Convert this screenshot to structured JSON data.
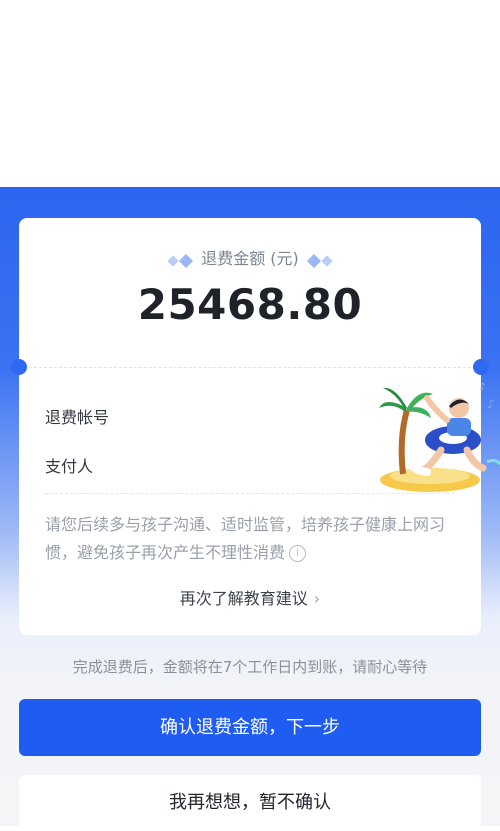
{
  "card": {
    "amount_label": "退费金额 (元)",
    "amount_value": "25468.80",
    "refund_account_label": "退费帐号",
    "payer_label": "支付人",
    "tip_text": "请您后续多与孩子沟通、适时监管，培养孩子健康上网习惯，避免孩子再次产生不理性消费",
    "learn_more_link": "再次了解教育建议"
  },
  "notice_text": "完成退费后，金额将在7个工作日内到账，请耐心等待",
  "buttons": {
    "confirm_label": "确认退费金额，下一步",
    "reconsider_label": "我再想想，暂不确认"
  },
  "colors": {
    "brand_blue": "#1f5cf1",
    "header_blue": "#2c66f0"
  }
}
